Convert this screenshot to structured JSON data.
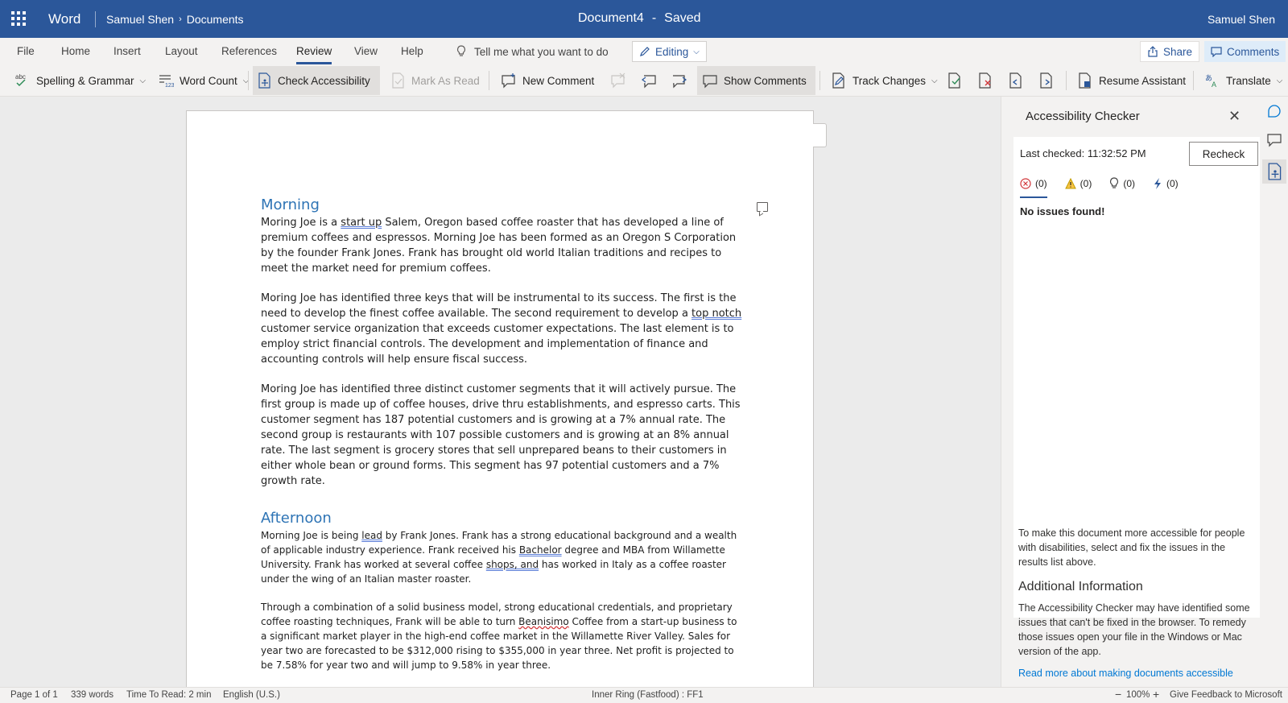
{
  "titlebar": {
    "app_name": "Word",
    "user": "Samuel Shen",
    "breadcrumb_owner": "Samuel Shen",
    "breadcrumb_folder": "Documents",
    "doc_title": "Document4",
    "separator": "-",
    "status": "Saved",
    "accent_color": "#2b579a"
  },
  "tabs": [
    "File",
    "Home",
    "Insert",
    "Layout",
    "References",
    "Review",
    "View",
    "Help"
  ],
  "active_tab": "Review",
  "tellme": "Tell me what you want to do",
  "editing_label": "Editing",
  "share_label": "Share",
  "comments_label": "Comments",
  "ribbon": {
    "spelling": "Spelling & Grammar",
    "word_count": "Word Count",
    "check_accessibility": "Check Accessibility",
    "mark_as_read": "Mark As Read",
    "new_comment": "New Comment",
    "show_comments": "Show Comments",
    "track_changes": "Track Changes",
    "resume_assistant": "Resume Assistant",
    "translate": "Translate"
  },
  "doc": {
    "h1": "Morning",
    "p1": [
      "Moring Joe is a ",
      "start up",
      " Salem, Oregon based coffee roaster that has developed a line of premium coffees and espressos. Morning Joe has been formed as an Oregon S Corporation by the founder Frank Jones. Frank has brought old world Italian traditions and recipes to meet the market need for premium coffees."
    ],
    "p2": [
      "Moring Joe has identified three keys that will be instrumental to its success. The first is the need to develop the finest coffee available. The second requirement to develop a ",
      "top notch",
      " customer service organization that exceeds customer expectations. The last element is to employ strict financial controls. The development and implementation of finance and accounting controls will help ensure fiscal success."
    ],
    "p3": "Moring Joe has identified three distinct customer segments that it will actively pursue. The first group is made up of coffee houses, drive thru establishments, and espresso carts. This customer segment has 187 potential customers and is growing at a 7% annual rate. The second group is restaurants with 107 possible customers and is growing at an 8% annual rate. The last segment is grocery stores that sell unprepared beans to their customers in either whole bean or ground forms. This segment has 97 potential customers and a 7% growth rate.",
    "h2": "Afternoon",
    "p4": [
      "Morning Joe is being ",
      "lead",
      " by Frank Jones. Frank has a strong educational background and a wealth of applicable industry experience. Frank received his ",
      "Bachelor",
      " degree and MBA from Willamette University. Frank has worked at several coffee ",
      "shops, and",
      " has worked in Italy as a coffee roaster under the wing of an Italian master roaster."
    ],
    "p5": [
      "Through a combination of a solid business model, strong educational credentials, and proprietary coffee roasting techniques, Frank will be able to turn ",
      "Beanisimo",
      " Coffee from a start-up business to a significant market player in the high-end coffee market in the Willamette River Valley. Sales for year two are forecasted to be $312,000 rising to $355,000 in year three. Net profit is projected to be 7.58% for year two and will jump to 9.58% in year three."
    ]
  },
  "pane": {
    "title": "Accessibility Checker",
    "last_checked": "Last checked: 11:32:52 PM",
    "recheck": "Recheck",
    "errors": "(0)",
    "warnings": "(0)",
    "tips": "(0)",
    "intelligent": "(0)",
    "no_issues": "No issues found!",
    "info": "To make this document more accessible for people with disabilities, select and fix the issues in the results list above.",
    "additional_title": "Additional Information",
    "additional_text": "The Accessibility Checker may have identified some issues that can't be fixed in the browser. To remedy those issues open your file in the Windows or Mac version of the app.",
    "read_more": "Read more about making documents accessible"
  },
  "statusbar": {
    "page": "Page 1 of 1",
    "words": "339 words",
    "read_time": "Time To Read: 2 min",
    "language": "English (U.S.)",
    "ring": "Inner Ring (Fastfood) : FF1",
    "zoom_minus": "−",
    "zoom": "100%",
    "zoom_plus": "+",
    "feedback": "Give Feedback to Microsoft"
  }
}
